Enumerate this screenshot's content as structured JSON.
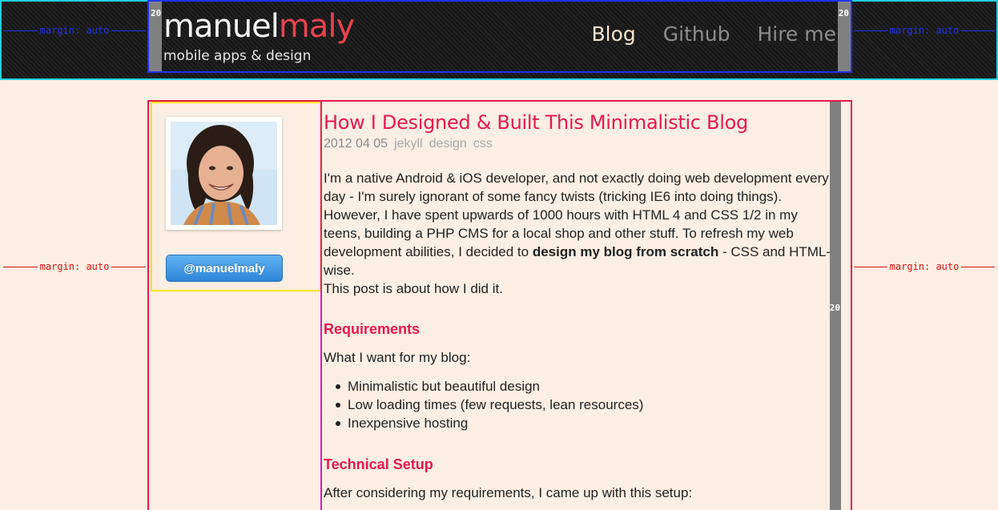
{
  "header": {
    "logo_first": "manuel",
    "logo_last": "maly",
    "tagline": "mobile apps & design",
    "nav": [
      "Blog",
      "Github",
      "Hire me"
    ],
    "padding_label": "20"
  },
  "markers": {
    "label": "margin: auto"
  },
  "sidebar": {
    "twitter_handle": "@manuelmaly"
  },
  "post": {
    "title": "How I Designed & Built This Minimalistic Blog",
    "date": "2012 04 05",
    "tags": [
      "jekyll",
      "design",
      "css"
    ],
    "intro_part1": "I'm a native Android & iOS developer, and not exactly doing web development every day - I'm surely ignorant of some fancy twists (tricking IE6 into doing things). However, I have spent upwards of 1000 hours with HTML 4 and CSS 1/2 in my teens, building a PHP CMS for a local shop and other stuff. To refresh my web development abilities, I decided to ",
    "intro_bold": "design my blog from scratch",
    "intro_part2": " - CSS and HTML-wise.",
    "intro_line2": "This post is about how I did it.",
    "requirements_heading": "Requirements",
    "requirements_intro": "What I want for my blog:",
    "requirements": [
      "Minimalistic but beautiful design",
      "Low loading times (few requests, lean resources)",
      "Inexpensive hosting"
    ],
    "setup_heading": "Technical Setup",
    "setup_intro": "After considering my requirements, I came up with this setup:"
  },
  "colors": {
    "accent": "#e8184e",
    "header_bg": "#1a1a1a",
    "page_bg": "#fbeee2",
    "guide_cyan": "#20d0e0",
    "guide_blue": "#2233ee",
    "guide_red": "#e01010",
    "guide_yellow": "#f5e51a",
    "guide_magenta": "#d818c8"
  }
}
